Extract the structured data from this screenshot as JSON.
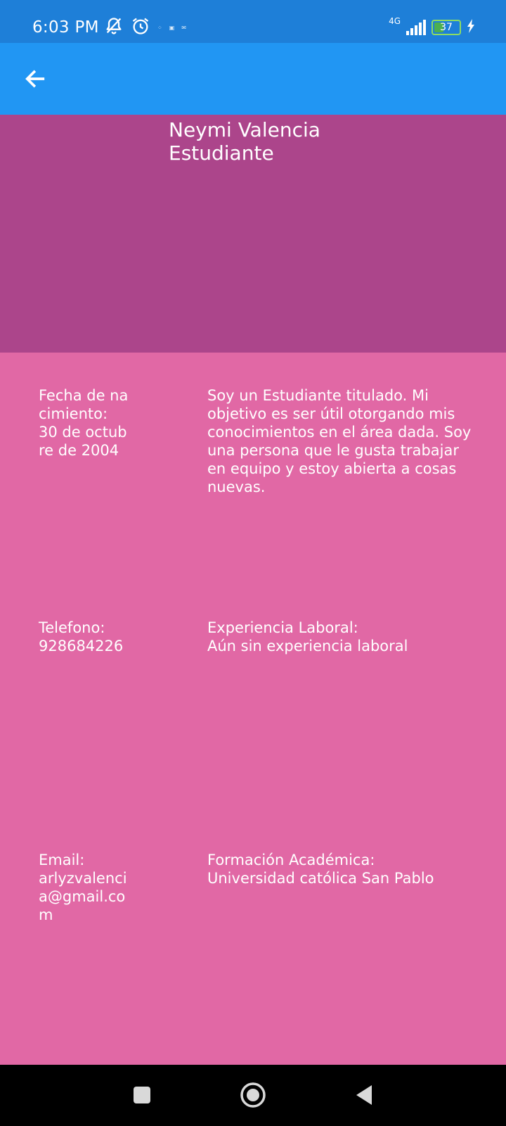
{
  "status_bar": {
    "time": "6:03 PM",
    "network": "4G",
    "battery": "37",
    "battery_level_percent": 37,
    "left_icons": [
      "muted-bell-icon",
      "alarm-icon"
    ],
    "right_icons": [
      "signal-icon",
      "battery-icon",
      "charging-icon"
    ]
  },
  "app_bar": {
    "back_icon": "arrow-left-icon"
  },
  "profile": {
    "name": "Neymi Valencia",
    "role": "Estudiante"
  },
  "details": {
    "birth": {
      "label": "Fecha de nacimiento:",
      "value": "30 de octubre de 2004"
    },
    "about": "Soy un Estudiante titulado. Mi objetivo es ser útil otorgando mis conocimientos en el área dada. Soy una persona que le gusta trabajar en equipo y estoy abierta a cosas nuevas.",
    "phone": {
      "label": "Telefono:",
      "value": "928684226"
    },
    "experience": {
      "label": "Experiencia Laboral:",
      "value": "Aún sin experiencia laboral"
    },
    "email": {
      "label": "Email:",
      "value": "arlyzvalencia@gmail.com"
    },
    "education": {
      "label": "Formación Académica:",
      "value": "Universidad católica San Pablo"
    }
  },
  "colors": {
    "status_bar": "#1e7fd8",
    "app_bar": "#2196f3",
    "header_panel": "#ac458b",
    "content_bg": "#e168a5",
    "nav_bar": "#000000"
  }
}
